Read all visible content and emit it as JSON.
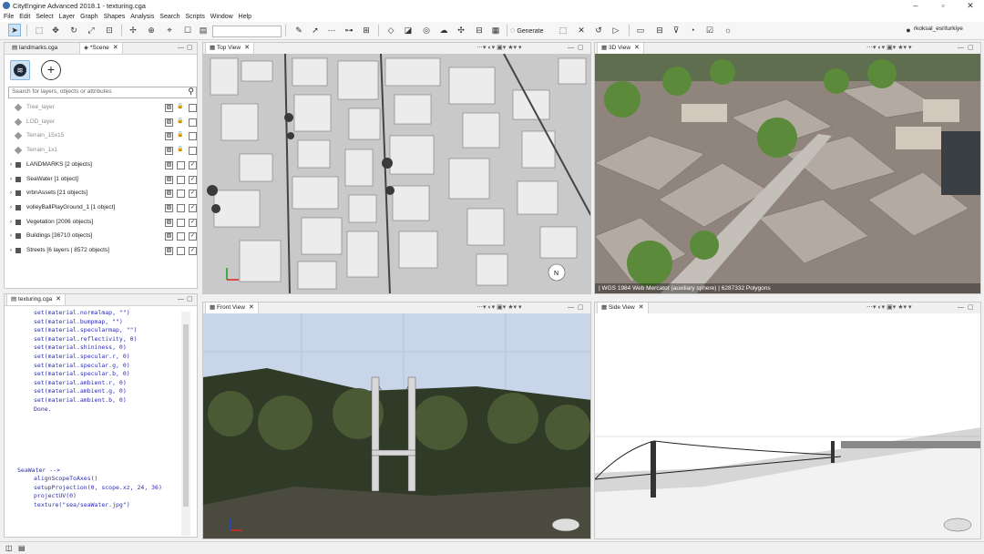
{
  "window": {
    "title": "CityEngine Advanced 2018.1 - texturing.cga",
    "min_icon": "minimize-icon",
    "max_icon": "maximize-icon",
    "close_icon": "close-icon"
  },
  "menu": [
    "File",
    "Edit",
    "Select",
    "Layer",
    "Graph",
    "Shapes",
    "Analysis",
    "Search",
    "Scripts",
    "Window",
    "Help"
  ],
  "toolbar": {
    "generate_label": "Generate",
    "user": "rkoksal_esriturkiye"
  },
  "scene_panel": {
    "tabs": [
      {
        "label": "landmarks.cga"
      },
      {
        "label": "*Scene"
      }
    ],
    "search_placeholder": "Search for layers, objects or attributes",
    "layers": [
      {
        "label": "Tree_layer",
        "dim": true,
        "locked": true,
        "checked": false
      },
      {
        "label": "LOD_layer",
        "dim": true,
        "locked": true,
        "checked": false
      },
      {
        "label": "Terrain_15x15",
        "dim": true,
        "locked": true,
        "checked": false
      },
      {
        "label": "Terrain_1x1",
        "dim": true,
        "locked": true,
        "checked": false
      },
      {
        "label": "LANDMARKS [2 objects]",
        "dim": false,
        "locked": false,
        "checked": true
      },
      {
        "label": "SeaWater [1 object]",
        "dim": false,
        "locked": false,
        "checked": true
      },
      {
        "label": "vrbnAssets [21 objects]",
        "dim": false,
        "locked": false,
        "checked": true
      },
      {
        "label": "volleyBallPlayGround_1 [1 object]",
        "dim": false,
        "locked": false,
        "checked": true
      },
      {
        "label": "Vegetation [2006 objects]",
        "dim": false,
        "locked": false,
        "checked": true
      },
      {
        "label": "Buildings [36710 objects]",
        "dim": false,
        "locked": false,
        "checked": true
      },
      {
        "label": "Streets [6 layers | 8572 objects]",
        "dim": false,
        "locked": false,
        "checked": true
      }
    ]
  },
  "code_panel": {
    "tab": "texturing.cga",
    "lines": [
      "set(material.normalmap, \"\")",
      "set(material.bumpmap, \"\")",
      "set(material.specularmap, \"\")",
      "set(material.reflectivity, 0)",
      "set(material.shininess, 0)",
      "set(material.specular.r, 0)",
      "set(material.specular.g, 0)",
      "set(material.specular.b, 0)",
      "set(material.ambient.r, 0)",
      "set(material.ambient.g, 0)",
      "set(material.ambient.b, 0)",
      "Done."
    ],
    "rule_name": "SeaWater -->",
    "rule_lines": [
      "alignScopeToAxes()",
      "setupProjection(0, scope.xz, 24, 36)",
      "projectUV(0)",
      "texture(\"sea/seaWater.jpg\")"
    ]
  },
  "viewports": {
    "top": {
      "tab": "Top View"
    },
    "three_d": {
      "tab": "3D View",
      "status": "| WGS 1984 Web Mercator (auxiliary sphere) | 6287332 Polygons"
    },
    "front": {
      "tab": "Front View"
    },
    "side": {
      "tab": "Side View"
    }
  },
  "colors": {
    "accent": "#3a6fb0",
    "selected_bg": "#cde3f7",
    "sky": "#c9d6ea"
  }
}
